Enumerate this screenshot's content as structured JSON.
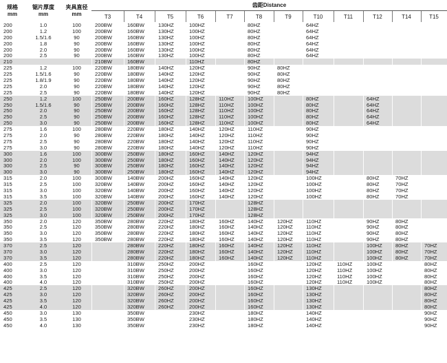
{
  "headers": {
    "spec": "规格\nmm",
    "thickness": "锯片厚度\nmm",
    "clamp": "夹具直径\nmm",
    "distance": "齿距Distance",
    "t_cols": [
      "T3",
      "T4",
      "T5",
      "T6",
      "T7",
      "T8",
      "T9",
      "T10",
      "T11",
      "T12",
      "T14",
      "T15"
    ]
  },
  "rows": [
    {
      "shade": false,
      "spec": "200",
      "thk": "1.0",
      "clamp": "100",
      "t": [
        "200BW",
        "160BW",
        "130HZ",
        "100HZ",
        "",
        "80HZ",
        "",
        "64HZ",
        "",
        "",
        "",
        ""
      ]
    },
    {
      "shade": false,
      "spec": "200",
      "thk": "1.2",
      "clamp": "100",
      "t": [
        "200BW",
        "160BW",
        "130HZ",
        "100HZ",
        "",
        "80HZ",
        "",
        "64HZ",
        "",
        "",
        "",
        ""
      ]
    },
    {
      "shade": false,
      "spec": "200",
      "thk": "1.5/1.6",
      "clamp": "90",
      "t": [
        "200BW",
        "160BW",
        "130HZ",
        "100HZ",
        "",
        "80HZ",
        "",
        "64HZ",
        "",
        "",
        "",
        ""
      ]
    },
    {
      "shade": false,
      "spec": "200",
      "thk": "1.8",
      "clamp": "90",
      "t": [
        "200BW",
        "160BW",
        "130HZ",
        "100HZ",
        "",
        "80HZ",
        "",
        "64HZ",
        "",
        "",
        "",
        ""
      ]
    },
    {
      "shade": false,
      "spec": "200",
      "thk": "2.0",
      "clamp": "90",
      "t": [
        "200BW",
        "160BW",
        "130HZ",
        "100HZ",
        "",
        "80HZ",
        "",
        "64HZ",
        "",
        "",
        "",
        ""
      ]
    },
    {
      "shade": false,
      "spec": "200",
      "thk": "2.5",
      "clamp": "90",
      "t": [
        "200BW",
        "160BW",
        "130HZ",
        "100HZ",
        "",
        "80HZ",
        "",
        "64HZ",
        "",
        "",
        "",
        ""
      ]
    },
    {
      "shade": true,
      "spec": "210",
      "thk": "",
      "clamp": "",
      "t": [
        "210BW",
        "160BW",
        "",
        "110HZ",
        "",
        "80HZ",
        "",
        "",
        "",
        "",
        "",
        ""
      ]
    },
    {
      "shade": false,
      "spec": "225",
      "thk": "1.2",
      "clamp": "100",
      "t": [
        "220BW",
        "180BW",
        "140HZ",
        "120HZ",
        "",
        "90HZ",
        "80HZ",
        "",
        "",
        "",
        "",
        ""
      ]
    },
    {
      "shade": false,
      "spec": "225",
      "thk": "1.5/1.6",
      "clamp": "90",
      "t": [
        "220BW",
        "180BW",
        "140HZ",
        "120HZ",
        "",
        "90HZ",
        "80HZ",
        "",
        "",
        "",
        "",
        ""
      ]
    },
    {
      "shade": false,
      "spec": "225",
      "thk": "1.8/1.9",
      "clamp": "90",
      "t": [
        "220BW",
        "180BW",
        "140HZ",
        "120HZ",
        "",
        "90HZ",
        "80HZ",
        "",
        "",
        "",
        "",
        ""
      ]
    },
    {
      "shade": false,
      "spec": "225",
      "thk": "2.0",
      "clamp": "90",
      "t": [
        "220BW",
        "180BW",
        "140HZ",
        "120HZ",
        "",
        "90HZ",
        "80HZ",
        "",
        "",
        "",
        "",
        ""
      ]
    },
    {
      "shade": false,
      "spec": "225",
      "thk": "2.5",
      "clamp": "90",
      "t": [
        "220BW",
        "180BW",
        "140HZ",
        "120HZ",
        "",
        "90HZ",
        "80HZ",
        "",
        "",
        "",
        "",
        ""
      ]
    },
    {
      "shade": true,
      "spec": "250",
      "thk": "1.2",
      "clamp": "100",
      "t": [
        "250BW",
        "200BW",
        "160HZ",
        "128HZ",
        "110HZ",
        "100HZ",
        "",
        "80HZ",
        "",
        "64HZ",
        "",
        ""
      ]
    },
    {
      "shade": true,
      "spec": "250",
      "thk": "1.5/1.6",
      "clamp": "90",
      "t": [
        "250BW",
        "200BW",
        "160HZ",
        "128HZ",
        "110HZ",
        "100HZ",
        "",
        "80HZ",
        "",
        "64HZ",
        "",
        ""
      ]
    },
    {
      "shade": true,
      "spec": "250",
      "thk": "2.0",
      "clamp": "90",
      "t": [
        "250BW",
        "200BW",
        "160HZ",
        "128HZ",
        "110HZ",
        "100HZ",
        "",
        "80HZ",
        "",
        "64HZ",
        "",
        ""
      ]
    },
    {
      "shade": true,
      "spec": "250",
      "thk": "2.5",
      "clamp": "90",
      "t": [
        "250BW",
        "200BW",
        "160HZ",
        "128HZ",
        "110HZ",
        "100HZ",
        "",
        "80HZ",
        "",
        "64HZ",
        "",
        ""
      ]
    },
    {
      "shade": true,
      "spec": "250",
      "thk": "3.0",
      "clamp": "90",
      "t": [
        "250BW",
        "200BW",
        "160HZ",
        "128HZ",
        "110HZ",
        "100HZ",
        "",
        "80HZ",
        "",
        "64HZ",
        "",
        ""
      ]
    },
    {
      "shade": false,
      "spec": "275",
      "thk": "1.6",
      "clamp": "100",
      "t": [
        "280BW",
        "220BW",
        "180HZ",
        "140HZ",
        "120HZ",
        "110HZ",
        "",
        "90HZ",
        "",
        "",
        "",
        ""
      ]
    },
    {
      "shade": false,
      "spec": "275",
      "thk": "2.0",
      "clamp": "90",
      "t": [
        "280BW",
        "220BW",
        "180HZ",
        "140HZ",
        "120HZ",
        "110HZ",
        "",
        "90HZ",
        "",
        "",
        "",
        ""
      ]
    },
    {
      "shade": false,
      "spec": "275",
      "thk": "2.5",
      "clamp": "90",
      "t": [
        "280BW",
        "220BW",
        "180HZ",
        "140HZ",
        "120HZ",
        "110HZ",
        "",
        "90HZ",
        "",
        "",
        "",
        ""
      ]
    },
    {
      "shade": false,
      "spec": "275",
      "thk": "3.0",
      "clamp": "90",
      "t": [
        "280BW",
        "220BW",
        "180HZ",
        "140HZ",
        "120HZ",
        "110HZ",
        "",
        "90HZ",
        "",
        "",
        "",
        ""
      ]
    },
    {
      "shade": true,
      "spec": "300",
      "thk": "1.6",
      "clamp": "100",
      "t": [
        "300BW",
        "250BW",
        "180HZ",
        "160HZ",
        "140HZ",
        "120HZ",
        "",
        "94HZ",
        "",
        "",
        "",
        ""
      ]
    },
    {
      "shade": true,
      "spec": "300",
      "thk": "2.0",
      "clamp": "100",
      "t": [
        "300BW",
        "250BW",
        "180HZ",
        "160HZ",
        "140HZ",
        "120HZ",
        "",
        "94HZ",
        "",
        "",
        "",
        ""
      ]
    },
    {
      "shade": true,
      "spec": "300",
      "thk": "2.5",
      "clamp": "90",
      "t": [
        "300BW",
        "250BW",
        "180HZ",
        "160HZ",
        "140HZ",
        "120HZ",
        "",
        "94HZ",
        "",
        "",
        "",
        ""
      ]
    },
    {
      "shade": true,
      "spec": "300",
      "thk": "3.0",
      "clamp": "90",
      "t": [
        "300BW",
        "250BW",
        "180HZ",
        "160HZ",
        "140HZ",
        "120HZ",
        "",
        "94HZ",
        "",
        "",
        "",
        ""
      ]
    },
    {
      "shade": false,
      "spec": "315",
      "thk": "2.0",
      "clamp": "100",
      "t": [
        "300BW",
        "140BW",
        "200HZ",
        "160HZ",
        "140HZ",
        "120HZ",
        "",
        "100HZ",
        "",
        "80HZ",
        "70HZ",
        ""
      ]
    },
    {
      "shade": false,
      "spec": "315",
      "thk": "2.5",
      "clamp": "100",
      "t": [
        "320BW",
        "140BW",
        "200HZ",
        "160HZ",
        "140HZ",
        "120HZ",
        "",
        "100HZ",
        "",
        "80HZ",
        "70HZ",
        ""
      ]
    },
    {
      "shade": false,
      "spec": "315",
      "thk": "3.0",
      "clamp": "100",
      "t": [
        "320BW",
        "140BW",
        "200HZ",
        "160HZ",
        "140HZ",
        "120HZ",
        "",
        "100HZ",
        "",
        "80HZ",
        "70HZ",
        ""
      ]
    },
    {
      "shade": false,
      "spec": "315",
      "thk": "3.5",
      "clamp": "100",
      "t": [
        "320BW",
        "140BW",
        "200HZ",
        "160HZ",
        "140HZ",
        "120HZ",
        "",
        "100HZ",
        "",
        "80HZ",
        "70HZ",
        ""
      ]
    },
    {
      "shade": true,
      "spec": "325",
      "thk": "2.0",
      "clamp": "100",
      "t": [
        "320BW",
        "250BW",
        "200HZ",
        "170HZ",
        "",
        "128HZ",
        "",
        "",
        "",
        "",
        "",
        ""
      ]
    },
    {
      "shade": true,
      "spec": "325",
      "thk": "2.5",
      "clamp": "100",
      "t": [
        "320BW",
        "250BW",
        "200HZ",
        "170HZ",
        "",
        "128HZ",
        "",
        "",
        "",
        "",
        "",
        ""
      ]
    },
    {
      "shade": true,
      "spec": "325",
      "thk": "3.0",
      "clamp": "100",
      "t": [
        "320BW",
        "250BW",
        "200HZ",
        "170HZ",
        "",
        "128HZ",
        "",
        "",
        "",
        "",
        "",
        ""
      ]
    },
    {
      "shade": false,
      "spec": "350",
      "thk": "2.0",
      "clamp": "120",
      "t": [
        "350BW",
        "280BW",
        "220HZ",
        "180HZ",
        "160HZ",
        "140HZ",
        "120HZ",
        "110HZ",
        "",
        "90HZ",
        "80HZ",
        ""
      ]
    },
    {
      "shade": false,
      "spec": "350",
      "thk": "2.5",
      "clamp": "120",
      "t": [
        "350BW",
        "280BW",
        "220HZ",
        "180HZ",
        "160HZ",
        "140HZ",
        "120HZ",
        "110HZ",
        "",
        "90HZ",
        "80HZ",
        ""
      ]
    },
    {
      "shade": false,
      "spec": "350",
      "thk": "3.0",
      "clamp": "120",
      "t": [
        "350BW",
        "280BW",
        "220HZ",
        "180HZ",
        "160HZ",
        "140HZ",
        "120HZ",
        "110HZ",
        "",
        "90HZ",
        "80HZ",
        ""
      ]
    },
    {
      "shade": false,
      "spec": "350",
      "thk": "3.5",
      "clamp": "120",
      "t": [
        "350BW",
        "280BW",
        "220HZ",
        "180HZ",
        "160HZ",
        "140HZ",
        "120HZ",
        "110HZ",
        "",
        "90HZ",
        "80HZ",
        ""
      ]
    },
    {
      "shade": true,
      "spec": "370",
      "thk": "2.5",
      "clamp": "120",
      "t": [
        "",
        "280BW",
        "220HZ",
        "180HZ",
        "160HZ",
        "140HZ",
        "120HZ",
        "110HZ",
        "",
        "100HZ",
        "80HZ",
        "70HZ"
      ]
    },
    {
      "shade": true,
      "spec": "370",
      "thk": "3.0",
      "clamp": "120",
      "t": [
        "",
        "280BW",
        "220HZ",
        "180HZ",
        "160HZ",
        "140HZ",
        "120HZ",
        "110HZ",
        "",
        "100HZ",
        "80HZ",
        "70HZ"
      ]
    },
    {
      "shade": true,
      "spec": "370",
      "thk": "3.5",
      "clamp": "120",
      "t": [
        "",
        "280BW",
        "220HZ",
        "180HZ",
        "160HZ",
        "140HZ",
        "120HZ",
        "110HZ",
        "",
        "100HZ",
        "80HZ",
        "70HZ"
      ]
    },
    {
      "shade": false,
      "spec": "400",
      "thk": "2.5",
      "clamp": "120",
      "t": [
        "",
        "310BW",
        "250HZ",
        "200HZ",
        "",
        "160HZ",
        "",
        "120HZ",
        "110HZ",
        "100HZ",
        "",
        "80HZ"
      ]
    },
    {
      "shade": false,
      "spec": "400",
      "thk": "3.0",
      "clamp": "120",
      "t": [
        "",
        "310BW",
        "250HZ",
        "200HZ",
        "",
        "160HZ",
        "",
        "120HZ",
        "110HZ",
        "100HZ",
        "",
        "80HZ"
      ]
    },
    {
      "shade": false,
      "spec": "400",
      "thk": "3.5",
      "clamp": "120",
      "t": [
        "",
        "310BW",
        "250HZ",
        "200HZ",
        "",
        "160HZ",
        "",
        "120HZ",
        "110HZ",
        "100HZ",
        "",
        "80HZ"
      ]
    },
    {
      "shade": false,
      "spec": "400",
      "thk": "4.0",
      "clamp": "120",
      "t": [
        "",
        "310BW",
        "250HZ",
        "200HZ",
        "",
        "160HZ",
        "",
        "120HZ",
        "110HZ",
        "100HZ",
        "",
        "80HZ"
      ]
    },
    {
      "shade": true,
      "spec": "425",
      "thk": "2.5",
      "clamp": "120",
      "t": [
        "",
        "320BW",
        "260HZ",
        "200HZ",
        "",
        "160HZ",
        "",
        "130HZ",
        "",
        "",
        "",
        "80HZ"
      ]
    },
    {
      "shade": true,
      "spec": "425",
      "thk": "3.0",
      "clamp": "120",
      "t": [
        "",
        "320BW",
        "260HZ",
        "200HZ",
        "",
        "160HZ",
        "",
        "130HZ",
        "",
        "",
        "",
        "80HZ"
      ]
    },
    {
      "shade": true,
      "spec": "425",
      "thk": "3.5",
      "clamp": "120",
      "t": [
        "",
        "320BW",
        "260HZ",
        "200HZ",
        "",
        "160HZ",
        "",
        "130HZ",
        "",
        "",
        "",
        "80HZ"
      ]
    },
    {
      "shade": true,
      "spec": "425",
      "thk": "4.0",
      "clamp": "120",
      "t": [
        "",
        "320BW",
        "260HZ",
        "200HZ",
        "",
        "160HZ",
        "",
        "130HZ",
        "",
        "",
        "",
        "80HZ"
      ]
    },
    {
      "shade": false,
      "spec": "450",
      "thk": "3.0",
      "clamp": "130",
      "t": [
        "",
        "350BW",
        "",
        "230HZ",
        "",
        "180HZ",
        "",
        "140HZ",
        "",
        "",
        "",
        "90HZ"
      ]
    },
    {
      "shade": false,
      "spec": "450",
      "thk": "3.5",
      "clamp": "130",
      "t": [
        "",
        "350BW",
        "",
        "230HZ",
        "",
        "180HZ",
        "",
        "140HZ",
        "",
        "",
        "",
        "90HZ"
      ]
    },
    {
      "shade": false,
      "spec": "450",
      "thk": "4.0",
      "clamp": "130",
      "t": [
        "",
        "350BW",
        "",
        "230HZ",
        "",
        "180HZ",
        "",
        "140HZ",
        "",
        "",
        "",
        "90HZ"
      ]
    }
  ]
}
